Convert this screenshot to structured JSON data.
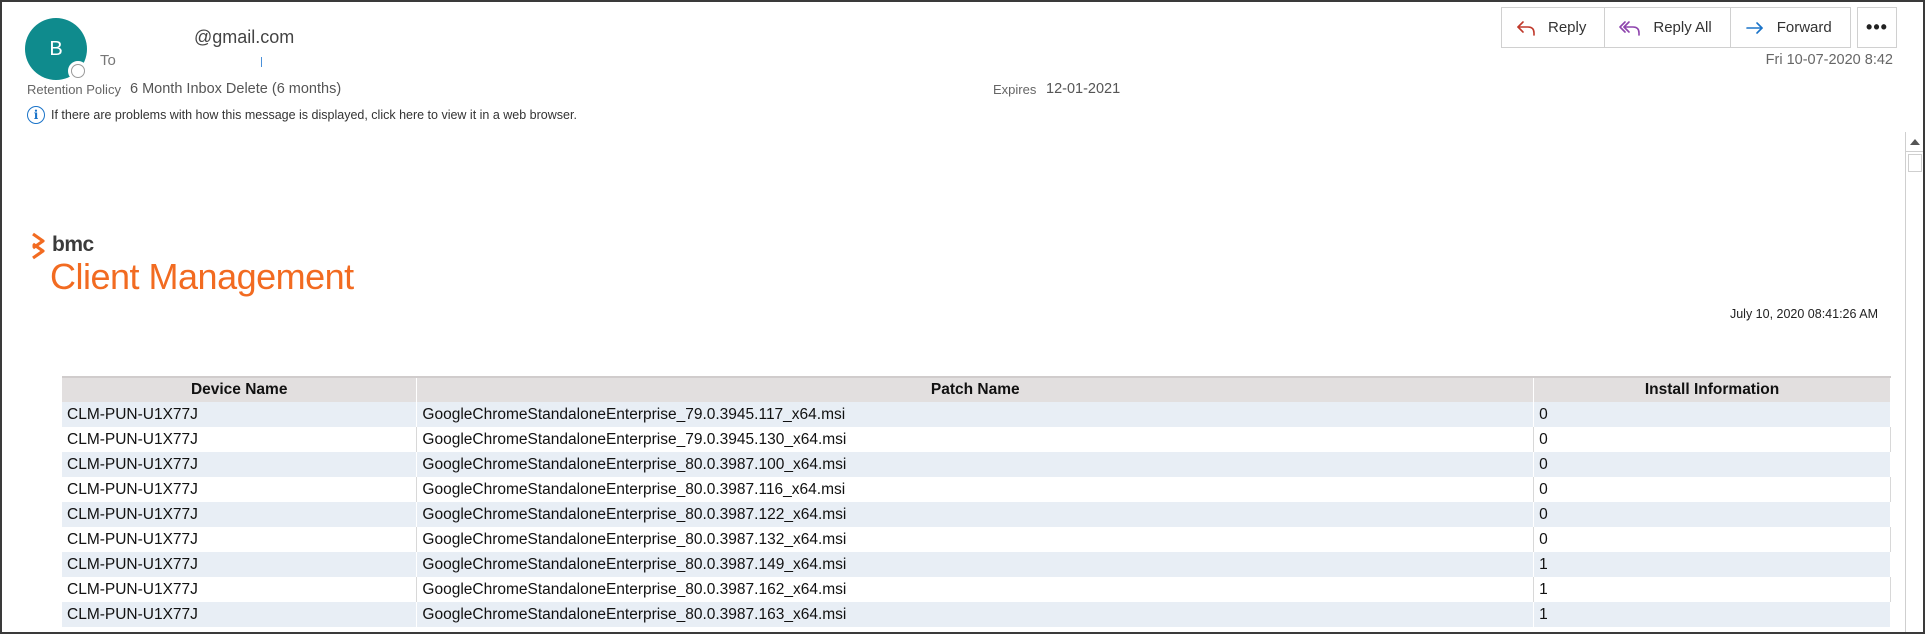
{
  "header": {
    "avatar_initial": "B",
    "sender": "@gmail.com",
    "to_label": "To",
    "retention_label": "Retention Policy",
    "retention_value": "6 Month Inbox Delete (6 months)",
    "expires_label": "Expires",
    "expires_value": "12-01-2021",
    "info_text": "If there are problems with how this message is displayed, click here to view it in a web browser.",
    "message_date": "Fri 10-07-2020 8:42",
    "actions": {
      "reply": "Reply",
      "reply_all": "Reply All",
      "forward": "Forward",
      "more": "•••"
    }
  },
  "body": {
    "logo_brand": "bmc",
    "logo_product": "Client Management",
    "report_date": "July 10, 2020 08:41:26 AM",
    "table": {
      "headers": [
        "Device Name",
        "Patch Name",
        "Install Information"
      ],
      "rows": [
        [
          "CLM-PUN-U1X77J",
          "GoogleChromeStandaloneEnterprise_79.0.3945.117_x64.msi",
          "0"
        ],
        [
          "CLM-PUN-U1X77J",
          "GoogleChromeStandaloneEnterprise_79.0.3945.130_x64.msi",
          "0"
        ],
        [
          "CLM-PUN-U1X77J",
          "GoogleChromeStandaloneEnterprise_80.0.3987.100_x64.msi",
          "0"
        ],
        [
          "CLM-PUN-U1X77J",
          "GoogleChromeStandaloneEnterprise_80.0.3987.116_x64.msi",
          "0"
        ],
        [
          "CLM-PUN-U1X77J",
          "GoogleChromeStandaloneEnterprise_80.0.3987.122_x64.msi",
          "0"
        ],
        [
          "CLM-PUN-U1X77J",
          "GoogleChromeStandaloneEnterprise_80.0.3987.132_x64.msi",
          "0"
        ],
        [
          "CLM-PUN-U1X77J",
          "GoogleChromeStandaloneEnterprise_80.0.3987.149_x64.msi",
          "1"
        ],
        [
          "CLM-PUN-U1X77J",
          "GoogleChromeStandaloneEnterprise_80.0.3987.162_x64.msi",
          "1"
        ],
        [
          "CLM-PUN-U1X77J",
          "GoogleChromeStandaloneEnterprise_80.0.3987.163_x64.msi",
          "1"
        ]
      ]
    }
  },
  "colors": {
    "avatar": "#0f8b8d",
    "brand_orange": "#f26b21",
    "reply_icon": "#c0392b",
    "reply_all_icon": "#8e44ad",
    "forward_icon": "#1a73c8",
    "row_alt": "#e8eef5",
    "header_bg": "#e2dfdf"
  },
  "icons": {
    "reply": "reply-arrow-icon",
    "reply_all": "reply-all-arrow-icon",
    "forward": "forward-arrow-icon",
    "info": "info-icon",
    "logo": "bmc-chevron-logo"
  }
}
